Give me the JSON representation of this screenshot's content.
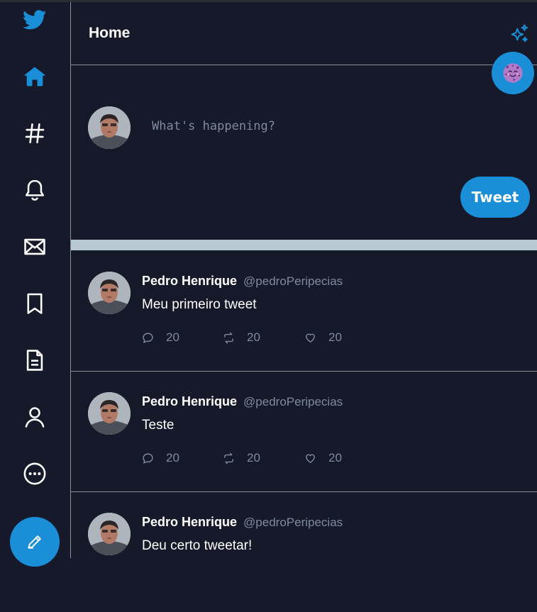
{
  "header": {
    "title": "Home"
  },
  "compose": {
    "placeholder": "What's happening?",
    "tweet_label": "Tweet"
  },
  "tweets": [
    {
      "name": "Pedro Henrique",
      "handle": "@pedroPeripecias",
      "text": "Meu primeiro tweet",
      "replies": "20",
      "retweets": "20",
      "likes": "20"
    },
    {
      "name": "Pedro Henrique",
      "handle": "@pedroPeripecias",
      "text": "Teste",
      "replies": "20",
      "retweets": "20",
      "likes": "20"
    },
    {
      "name": "Pedro Henrique",
      "handle": "@pedroPeripecias",
      "text": "Deu certo tweetar!"
    }
  ],
  "sidebar": {
    "icons": [
      "twitter-logo-icon",
      "home-icon",
      "hashtag-icon",
      "bell-icon",
      "mail-icon",
      "bookmark-icon",
      "lists-icon",
      "profile-icon",
      "more-icon",
      "pencil-icon"
    ]
  },
  "colors": {
    "background": "#15192a",
    "accent": "#1a8fd8",
    "muted": "#7f8aa0",
    "divider": "#b8c9d3"
  }
}
